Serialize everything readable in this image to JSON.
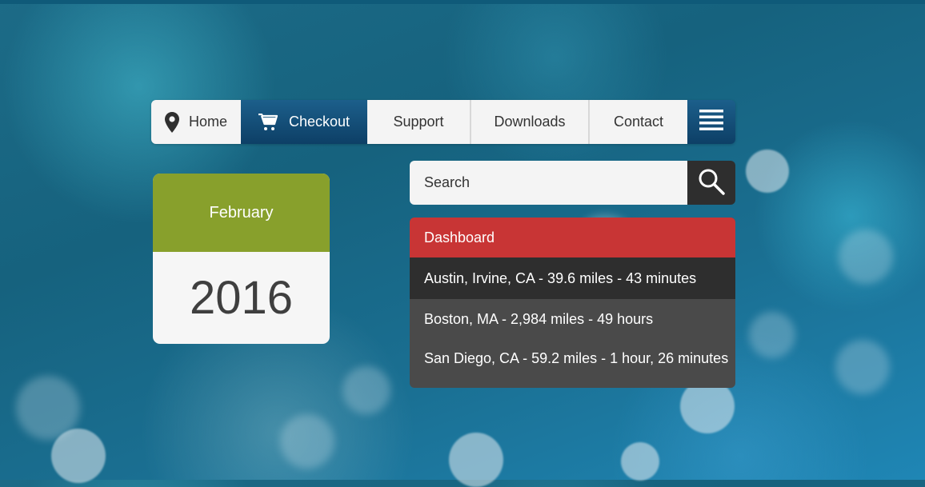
{
  "theme": {
    "nav_active": "#134c76",
    "calendar_accent": "#88a02c",
    "dashboard_header": "#c83535",
    "dashboard_active_row": "#2e2e2e",
    "dashboard_body": "#4a4a4a"
  },
  "nav": {
    "items": [
      {
        "label": "Home",
        "icon": "map-pin-icon",
        "active": false
      },
      {
        "label": "Checkout",
        "icon": "cart-icon",
        "active": true
      },
      {
        "label": "Support",
        "active": false
      },
      {
        "label": "Downloads",
        "active": false
      },
      {
        "label": "Contact",
        "active": false
      }
    ],
    "menu_icon": "hamburger-menu-icon"
  },
  "calendar": {
    "month": "February",
    "year": "2016"
  },
  "search": {
    "placeholder": "Search",
    "icon": "search-icon"
  },
  "dashboard": {
    "title": "Dashboard",
    "rows": [
      {
        "text": "Austin, Irvine, CA - 39.6 miles - 43 minutes",
        "active": true
      },
      {
        "text": "Boston, MA - 2,984 miles - 49 hours",
        "active": false
      },
      {
        "text": "San Diego, CA - 59.2 miles - 1 hour, 26 minutes",
        "active": false
      }
    ]
  }
}
